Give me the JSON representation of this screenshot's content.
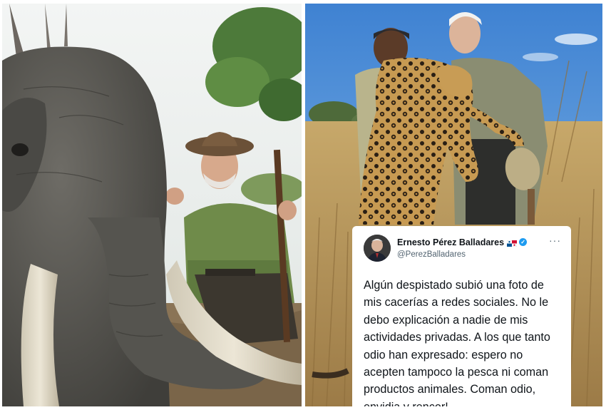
{
  "tweet": {
    "author_name": "Ernesto Pérez Balladares",
    "handle": "@PerezBalladares",
    "more_glyph": "···",
    "text": "Algún despistado subió una foto de mis cacerías a redes sociales. No le debo explicación a nadie de mis actividades privadas. A los que tanto odio han expresado: espero no acepten tampoco la pesca ni coman productos animales. Coman odio, envidia y rencor!"
  },
  "colors": {
    "sky_left": "#e9eef0",
    "sky_right": "#4f8fd6",
    "grass": "#b99a5f",
    "elephant": "#5a5955",
    "shirt": "#6f8b4a",
    "verified": "#1d9bf0"
  },
  "icons": {
    "verified": "verified-badge-icon",
    "flag": "panama-flag-icon",
    "more": "more-options-icon"
  }
}
